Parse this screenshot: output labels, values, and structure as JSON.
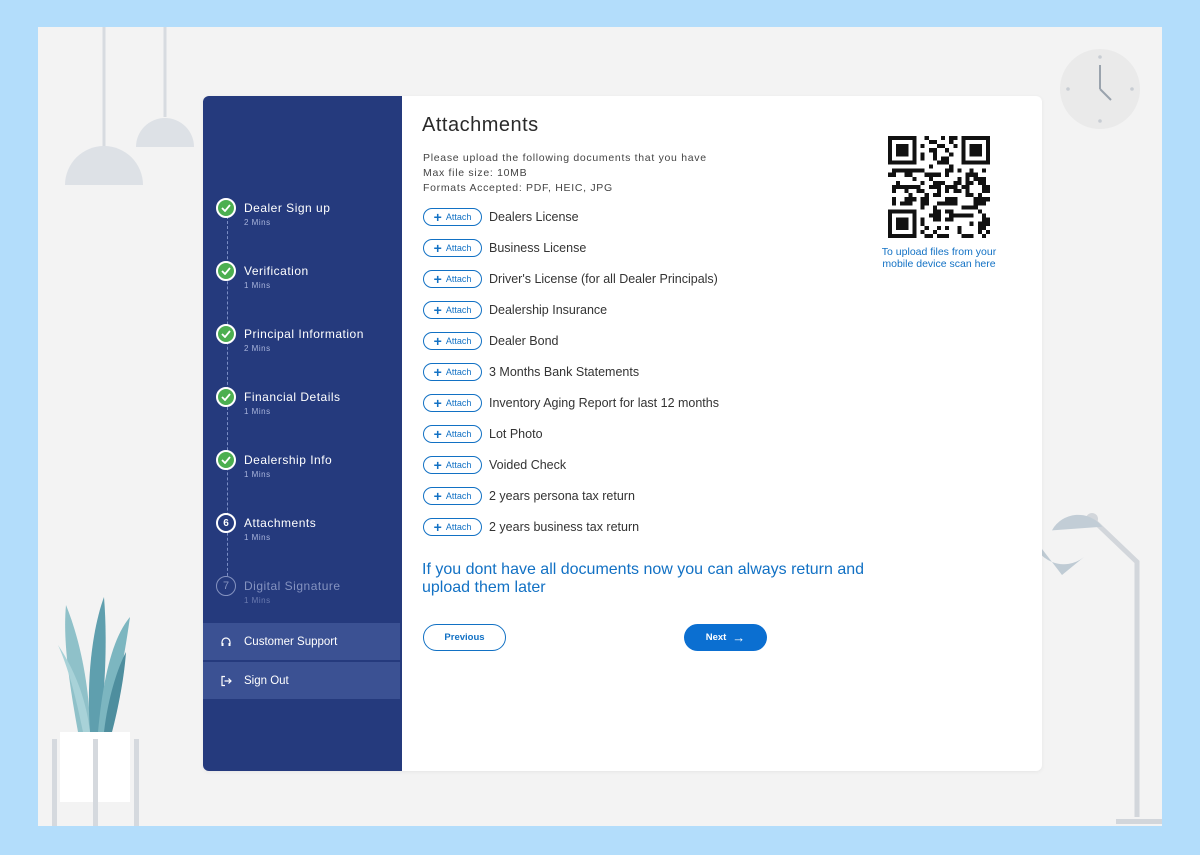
{
  "colors": {
    "sidebar": "#253a7d",
    "sidebar_button": "#3b5193",
    "accent": "#1271c4",
    "success": "#4caf50",
    "background": "#b3ddfb"
  },
  "sidebar": {
    "steps": [
      {
        "title": "Dealer Sign up",
        "duration": "2 Mins",
        "status": "done",
        "icon": "check-icon"
      },
      {
        "title": "Verification",
        "duration": "1 Mins",
        "status": "done",
        "icon": "check-icon"
      },
      {
        "title": "Principal Information",
        "duration": "2 Mins",
        "status": "done",
        "icon": "check-icon"
      },
      {
        "title": "Financial Details",
        "duration": "1 Mins",
        "status": "done",
        "icon": "check-icon"
      },
      {
        "title": "Dealership Info",
        "duration": "1 Mins",
        "status": "done",
        "icon": "check-icon"
      },
      {
        "title": "Attachments",
        "duration": "1 Mins",
        "status": "active",
        "number": "6"
      },
      {
        "title": "Digital Signature",
        "duration": "1 Mins",
        "status": "pending",
        "number": "7"
      }
    ],
    "support_label": "Customer Support",
    "signout_label": "Sign Out"
  },
  "main": {
    "title": "Attachments",
    "info": [
      "Please upload the following documents that you have",
      "Max file size: 10MB",
      "Formats Accepted: PDF, HEIC, JPG"
    ],
    "attach_label": "Attach",
    "documents": [
      "Dealers License",
      "Business License",
      "Driver's License (for all Dealer Principals)",
      "Dealership Insurance",
      "Dealer Bond",
      "3 Months Bank Statements",
      "Inventory Aging Report for last 12 months",
      "Lot Photo",
      "Voided Check",
      "2 years persona tax return",
      "2 years business tax return"
    ],
    "note": "If you dont have all documents now you can always return and upload them later",
    "previous_label": "Previous",
    "next_label": "Next",
    "qr_caption": "To upload files from your mobile device scan here"
  }
}
